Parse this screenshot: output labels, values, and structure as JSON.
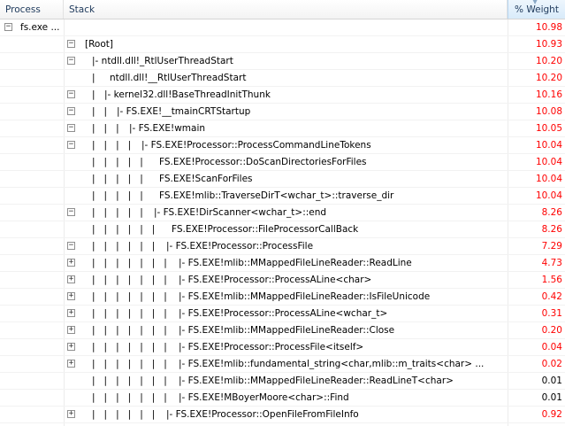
{
  "header": {
    "process_label": "Process",
    "stack_label": "Stack",
    "weight_label": "% Weight"
  },
  "colors": {
    "weight_high": "#ff0000",
    "weight_low": "#000000"
  },
  "rows": [
    {
      "process": "fs.exe ...",
      "exp": "minus",
      "guides": "",
      "label": "",
      "weight": "10.98",
      "hot": true
    },
    {
      "process": "",
      "exp": "minus",
      "guides": "",
      "label": "[Root]",
      "weight": "10.93",
      "hot": true
    },
    {
      "process": "",
      "exp": "minus",
      "guides": "",
      "label": "|- ntdll.dll!_RtlUserThreadStart",
      "weight": "10.20",
      "hot": true
    },
    {
      "process": "",
      "exp": "",
      "guides": "|",
      "label": "ntdll.dll!__RtlUserThreadStart",
      "weight": "10.20",
      "hot": true
    },
    {
      "process": "",
      "exp": "minus",
      "guides": "|",
      "label": "|- kernel32.dll!BaseThreadInitThunk",
      "weight": "10.16",
      "hot": true
    },
    {
      "process": "",
      "exp": "minus",
      "guides": "|   |",
      "label": "|- FS.EXE!__tmainCRTStartup",
      "weight": "10.08",
      "hot": true
    },
    {
      "process": "",
      "exp": "minus",
      "guides": "|   |   |",
      "label": "|- FS.EXE!wmain",
      "weight": "10.05",
      "hot": true
    },
    {
      "process": "",
      "exp": "minus",
      "guides": "|   |   |   |",
      "label": "|- FS.EXE!Processor::ProcessCommandLineTokens",
      "weight": "10.04",
      "hot": true
    },
    {
      "process": "",
      "exp": "",
      "guides": "|   |   |   |   |",
      "label": "FS.EXE!Processor::DoScanDirectoriesForFiles",
      "weight": "10.04",
      "hot": true
    },
    {
      "process": "",
      "exp": "",
      "guides": "|   |   |   |   |",
      "label": "FS.EXE!ScanForFiles",
      "weight": "10.04",
      "hot": true
    },
    {
      "process": "",
      "exp": "",
      "guides": "|   |   |   |   |",
      "label": "FS.EXE!mlib::TraverseDirT<wchar_t>::traverse_dir",
      "weight": "10.04",
      "hot": true
    },
    {
      "process": "",
      "exp": "minus",
      "guides": "|   |   |   |   |",
      "label": "|- FS.EXE!DirScanner<wchar_t>::end",
      "weight": "8.26",
      "hot": true
    },
    {
      "process": "",
      "exp": "",
      "guides": "|   |   |   |   |   |",
      "label": "FS.EXE!Processor::FileProcessorCallBack",
      "weight": "8.26",
      "hot": true
    },
    {
      "process": "",
      "exp": "minus",
      "guides": "|   |   |   |   |   |",
      "label": "|- FS.EXE!Processor::ProcessFile",
      "weight": "7.29",
      "hot": true
    },
    {
      "process": "",
      "exp": "plus",
      "guides": "|   |   |   |   |   |   |",
      "label": "|- FS.EXE!mlib::MMappedFileLineReader::ReadLine",
      "weight": "4.73",
      "hot": true
    },
    {
      "process": "",
      "exp": "plus",
      "guides": "|   |   |   |   |   |   |",
      "label": "|- FS.EXE!Processor::ProcessALine<char>",
      "weight": "1.56",
      "hot": true
    },
    {
      "process": "",
      "exp": "plus",
      "guides": "|   |   |   |   |   |   |",
      "label": "|- FS.EXE!mlib::MMappedFileLineReader::IsFileUnicode",
      "weight": "0.42",
      "hot": true
    },
    {
      "process": "",
      "exp": "plus",
      "guides": "|   |   |   |   |   |   |",
      "label": "|- FS.EXE!Processor::ProcessALine<wchar_t>",
      "weight": "0.31",
      "hot": true
    },
    {
      "process": "",
      "exp": "plus",
      "guides": "|   |   |   |   |   |   |",
      "label": "|- FS.EXE!mlib::MMappedFileLineReader::Close",
      "weight": "0.20",
      "hot": true
    },
    {
      "process": "",
      "exp": "plus",
      "guides": "|   |   |   |   |   |   |",
      "label": "|- FS.EXE!Processor::ProcessFile<itself>",
      "weight": "0.04",
      "hot": true
    },
    {
      "process": "",
      "exp": "plus",
      "guides": "|   |   |   |   |   |   |",
      "label": "|- FS.EXE!mlib::fundamental_string<char,mlib::m_traits<char> ...",
      "weight": "0.02",
      "hot": true
    },
    {
      "process": "",
      "exp": "",
      "guides": "|   |   |   |   |   |   |",
      "label": "|- FS.EXE!mlib::MMappedFileLineReader::ReadLineT<char>",
      "weight": "0.01",
      "hot": false
    },
    {
      "process": "",
      "exp": "",
      "guides": "|   |   |   |   |   |   |",
      "label": "|- FS.EXE!MBoyerMoore<char>::Find",
      "weight": "0.01",
      "hot": false
    },
    {
      "process": "",
      "exp": "plus",
      "guides": "|   |   |   |   |   |",
      "label": "|- FS.EXE!Processor::OpenFileFromFileInfo",
      "weight": "0.92",
      "hot": true
    }
  ]
}
